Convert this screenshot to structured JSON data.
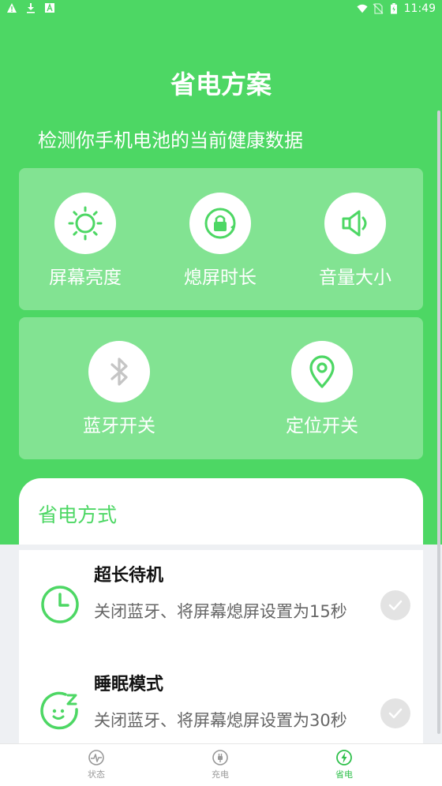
{
  "status_bar": {
    "time": "11:49",
    "left_icons": [
      "warning-icon",
      "download-icon",
      "font-icon"
    ],
    "right_icons": [
      "wifi-icon",
      "no-sim-icon",
      "battery-icon"
    ]
  },
  "header": {
    "title": "省电方案",
    "subtitle": "检测你手机电池的当前健康数据"
  },
  "tools_row1": [
    {
      "label": "屏幕亮度",
      "icon": "brightness-icon"
    },
    {
      "label": "熄屏时长",
      "icon": "screen-timeout-icon"
    },
    {
      "label": "音量大小",
      "icon": "volume-icon"
    }
  ],
  "tools_row2": [
    {
      "label": "蓝牙开关",
      "icon": "bluetooth-icon"
    },
    {
      "label": "定位开关",
      "icon": "location-icon"
    }
  ],
  "section": {
    "title": "省电方式"
  },
  "modes": [
    {
      "title": "超长待机",
      "desc": "关闭蓝牙、将屏幕熄屏设置为15秒",
      "icon": "clock-icon",
      "checked": false
    },
    {
      "title": "睡眠模式",
      "desc": "关闭蓝牙、将屏幕熄屏设置为30秒",
      "icon": "sleep-icon",
      "checked": false
    }
  ],
  "bottom_nav": [
    {
      "label": "状态",
      "icon": "status-icon",
      "active": false
    },
    {
      "label": "充电",
      "icon": "charge-icon",
      "active": false
    },
    {
      "label": "省电",
      "icon": "power-save-icon",
      "active": true
    }
  ],
  "colors": {
    "primary": "#4dd764",
    "active_nav": "#2fc04b",
    "panel_overlay": "rgba(255,255,255,0.30)"
  }
}
